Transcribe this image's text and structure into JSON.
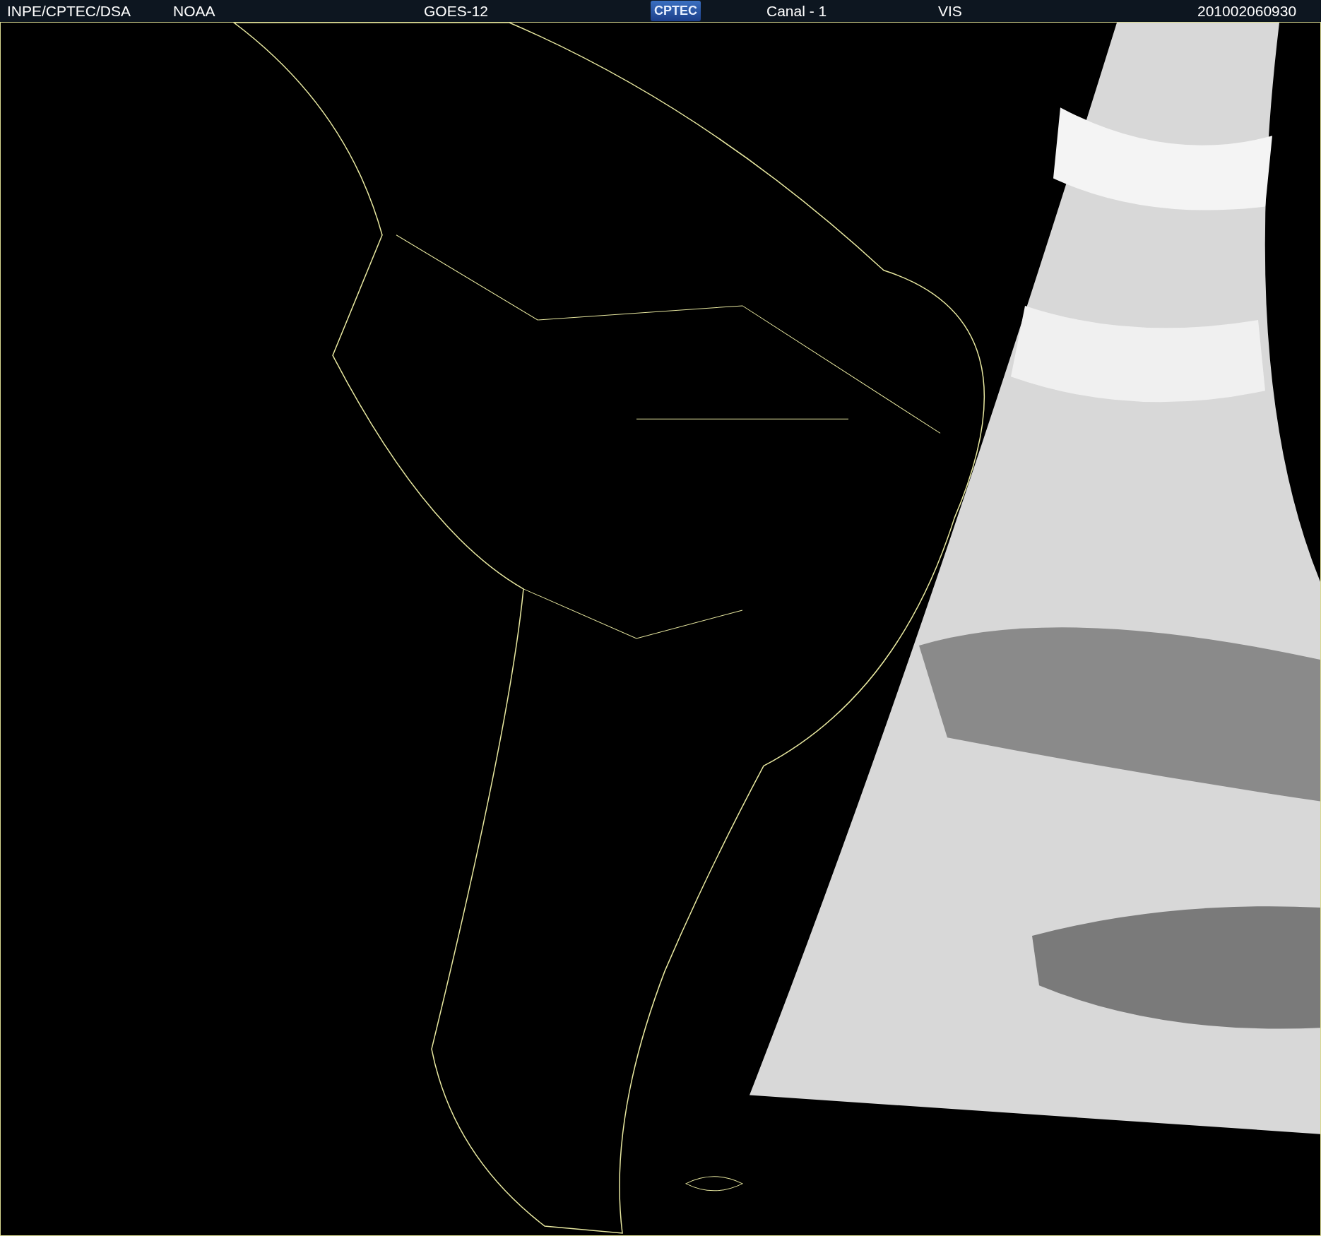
{
  "header": {
    "items": [
      {
        "kind": "text",
        "text": "INPE/CPTEC/DSA"
      },
      {
        "kind": "text",
        "text": "NOAA"
      },
      {
        "kind": "text",
        "text": "GOES-12"
      },
      {
        "kind": "logo",
        "text": "CPTEC"
      },
      {
        "kind": "text",
        "text": "Canal - 1"
      },
      {
        "kind": "text",
        "text": "VIS"
      },
      {
        "kind": "text",
        "text": "201002060930"
      }
    ]
  }
}
